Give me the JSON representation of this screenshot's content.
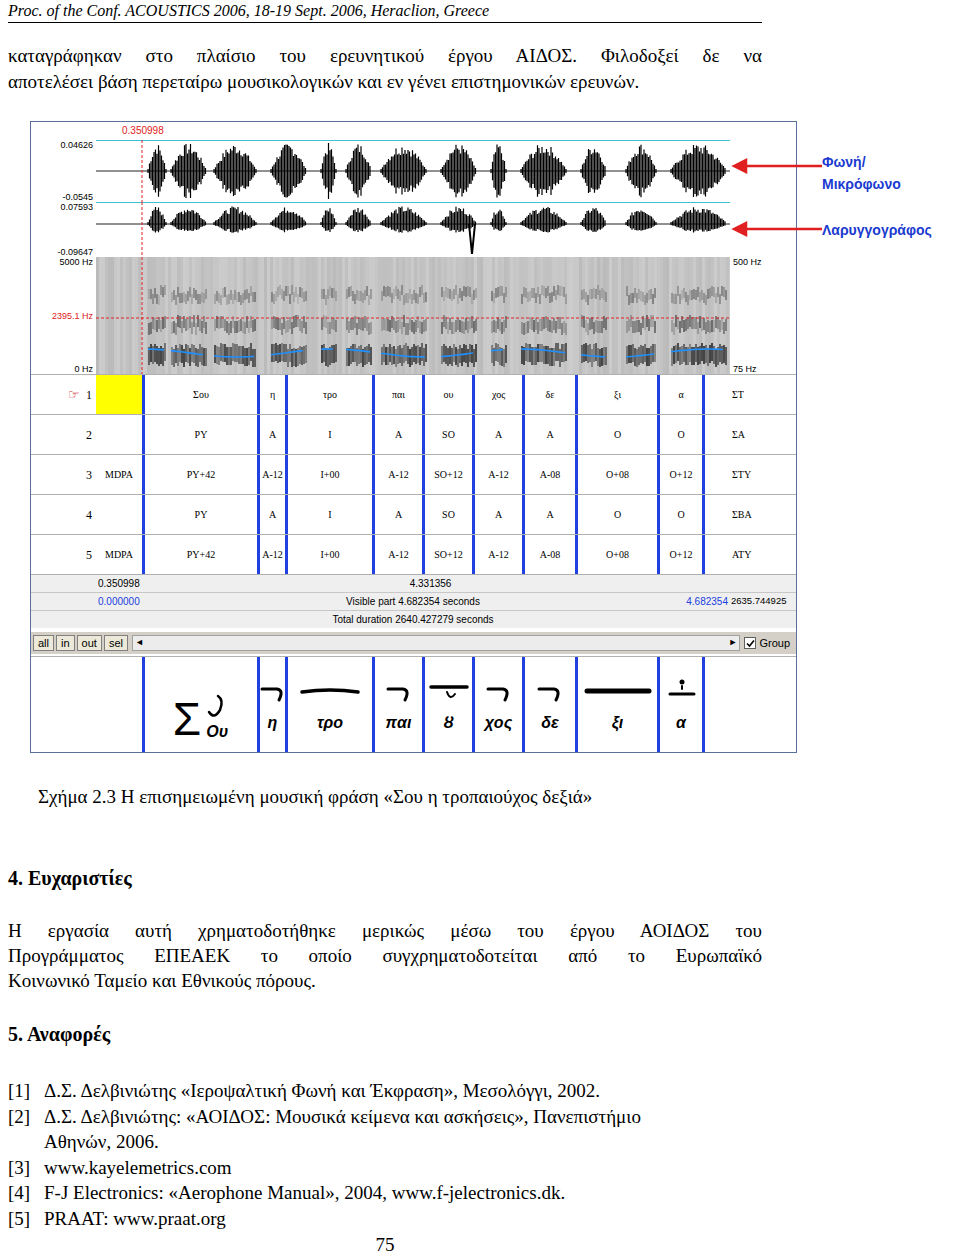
{
  "header": "Proc. of the Conf. ACOUSTICS 2006, 18-19 Sept. 2006, Heraclion, Greece",
  "intro": [
    "καταγράφηκαν στο πλαίσιο του ερευνητικού έργου ΑΙΔΟΣ. Φιλοδοξεί δε να",
    "αποτελέσει βάση περεταίρω μουσικολογικών και εν γένει επιστημονικών ερευνών."
  ],
  "figure": {
    "cursor_time": "0.350998",
    "voice_axis": {
      "top": "0.04626",
      "bottom": "-0.0545"
    },
    "laryngograph_axis": {
      "top": "0.07593",
      "bottom": "-0.09647"
    },
    "spectrogram_axis": {
      "top": "5000 Hz",
      "marker": "2395.1 Hz",
      "bottom": "0 Hz",
      "pitch_top": "500 Hz",
      "pitch_bottom": "75 Hz"
    },
    "annotations": [
      {
        "lines": [
          "Φωνή/",
          "Μικρόφωνο"
        ]
      },
      {
        "lines": [
          "Λαρυγγογράφος"
        ]
      }
    ],
    "tier_pointer": "☞",
    "tiers": [
      {
        "number": "1",
        "name": "ΣΤ",
        "selected": true,
        "lead": "",
        "cells": [
          "Σου",
          "η",
          "τρο",
          "παι",
          "ου",
          "χος",
          "δε",
          "ξι",
          "α"
        ]
      },
      {
        "number": "2",
        "name": "ΣΑ",
        "selected": false,
        "lead": "",
        "cells": [
          "PY",
          "A",
          "I",
          "A",
          "SO",
          "A",
          "A",
          "O",
          "O"
        ]
      },
      {
        "number": "3",
        "name": "ΣΤΥ",
        "selected": false,
        "lead": "MDPA",
        "cells": [
          "PY+42",
          "A-12",
          "I+00",
          "A-12",
          "SO+12",
          "A-12",
          "A-08",
          "O+08",
          "O+12"
        ]
      },
      {
        "number": "4",
        "name": "ΣΒΑ",
        "selected": false,
        "lead": "",
        "cells": [
          "PY",
          "A",
          "I",
          "A",
          "SO",
          "A",
          "A",
          "O",
          "O"
        ]
      },
      {
        "number": "5",
        "name": "ΑΤΥ",
        "selected": false,
        "lead": "MDPA",
        "cells": [
          "PY+42",
          "A-12",
          "I+00",
          "A-12",
          "SO+12",
          "A-12",
          "A-08",
          "O+08",
          "O+12"
        ]
      }
    ],
    "info": {
      "selection_start": "0.350998",
      "selection_end": "4.331356",
      "window_start": "0.000000",
      "visible": "Visible part 4.682354 seconds",
      "window_end": "4.682354",
      "total_end": "2635.744925",
      "total": "Total duration 2640.427279 seconds"
    },
    "buttons": [
      "all",
      "in",
      "out",
      "sel"
    ],
    "scroll": {
      "left": "◄",
      "right": "►"
    },
    "group": {
      "label": "Group",
      "checked": true
    },
    "notation": {
      "initial": "Σ",
      "syllables": [
        "Ου",
        "η",
        "τρο",
        "παι",
        "ȣ",
        "χος",
        "δε",
        "ξι",
        "α"
      ]
    }
  },
  "caption": "Σχήμα 2.3 Η επισημειωμένη μουσική φράση «Σου η τροπαιούχος δεξιά»",
  "acknowledgments": {
    "title": "4. Ευχαριστίες",
    "lines": [
      "Η εργασία αυτή χρηματοδοτήθηκε μερικώς μέσω του έργου ΑΟΙΔΟΣ του",
      "Προγράμματος ΕΠΕΑΕΚ το οποίο συγχρηματοδοτείται από το Ευρωπαϊκό",
      "Κοινωνικό Ταμείο και Εθνικούς πόρους."
    ]
  },
  "references": {
    "title": "5. Αναφορές",
    "items": [
      {
        "label": "[1]",
        "lines": [
          "Δ.Σ. Δελβινιώτης «Ιεροψαλτική Φωνή και Έκφραση», Μεσολόγγι, 2002."
        ]
      },
      {
        "label": "[2]",
        "lines": [
          "Δ.Σ. Δελβινιώτης: «ΑΟΙΔΟΣ: Μουσικά κείμενα και ασκήσεις», Πανεπιστήμιο",
          "Αθηνών, 2006."
        ]
      },
      {
        "label": "[3]",
        "lines": [
          "www.kayelemetrics.com"
        ]
      },
      {
        "label": "[4]",
        "lines": [
          "F-J Electronics: «Aerophone Manual», 2004, www.f-jelectronics.dk."
        ]
      },
      {
        "label": "[5]",
        "lines": [
          "PRAAT: www.praat.org"
        ]
      }
    ]
  },
  "page_number": "75"
}
